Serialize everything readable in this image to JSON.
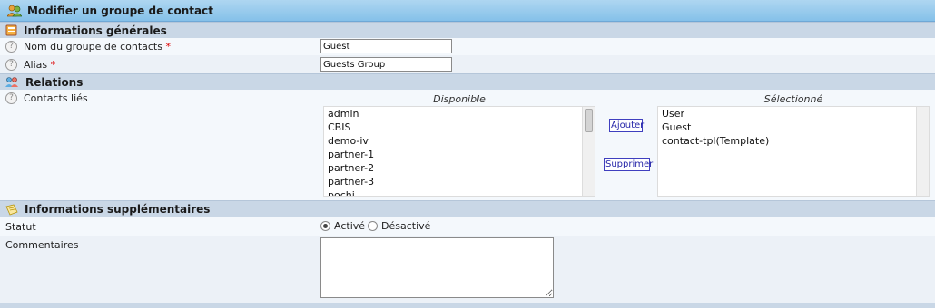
{
  "header": {
    "title": "Modifier un groupe de contact"
  },
  "sections": {
    "general": "Informations générales",
    "relations": "Relations",
    "additional": "Informations supplémentaires"
  },
  "fields": {
    "group_name": {
      "label": "Nom du groupe de contacts",
      "required": "*",
      "value": "Guest"
    },
    "alias": {
      "label": "Alias",
      "required": "*",
      "value": "Guests Group"
    },
    "linked_contacts": {
      "label": "Contacts liés"
    },
    "status": {
      "label": "Statut",
      "options": [
        "Activé",
        "Désactivé"
      ],
      "selected": "Activé"
    },
    "comments": {
      "label": "Commentaires",
      "value": ""
    }
  },
  "relations": {
    "available_header": "Disponible",
    "selected_header": "Sélectionné",
    "available": [
      "admin",
      "CBIS",
      "demo-iv",
      "partner-1",
      "partner-2",
      "partner-3",
      "pochi"
    ],
    "selected": [
      "User",
      "Guest",
      "contact-tpl(Template)"
    ],
    "add_label": "Ajouter",
    "remove_label": "Supprimer"
  },
  "icons": {
    "title": "group-icon",
    "general": "book-icon",
    "relations": "users-icon",
    "additional": "notes-icon",
    "help": "help-icon"
  },
  "colors": {
    "title_bar": "#9fcdee",
    "section_head": "#c9d7e6",
    "button_text": "#2525a8",
    "required": "#dd0000"
  }
}
